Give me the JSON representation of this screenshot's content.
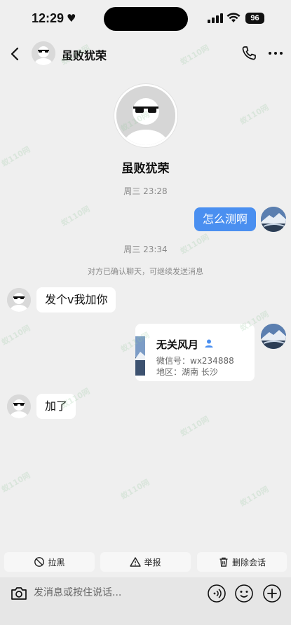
{
  "status_bar": {
    "time": "12:29",
    "heart": "♥",
    "battery": "96"
  },
  "header": {
    "contact_name": "虽败犹荣"
  },
  "profile": {
    "name": "虽败犹荣"
  },
  "timestamps": [
    "周三 23:28",
    "周三 23:34"
  ],
  "system_message": "对方已确认聊天，可继续发送消息",
  "messages": [
    {
      "from": "me",
      "text": "怎么测啊"
    },
    {
      "from": "other",
      "text": "发个v我加你"
    },
    {
      "from": "me",
      "type": "contact_card",
      "name": "无关风月",
      "wechat_id": "微信号：wx234888",
      "region": "地区：湖南 长沙"
    },
    {
      "from": "other",
      "text": "加了"
    }
  ],
  "actions": {
    "block": "拉黑",
    "report": "举报",
    "delete": "删除会话"
  },
  "input": {
    "placeholder": "发消息或按住说话..."
  },
  "watermark": "蚁110网",
  "colors": {
    "accent": "#4a8ff0",
    "background": "#efefef"
  }
}
